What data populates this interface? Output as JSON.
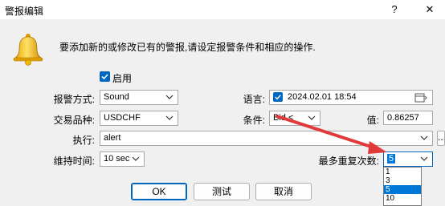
{
  "window": {
    "title": "警报编辑",
    "help": "?",
    "close": "✕"
  },
  "intro": {
    "text": "要添加新的或修改已有的警报,请设定报警条件和相应的操作."
  },
  "enable": {
    "label": "启用",
    "checked": true
  },
  "fields": {
    "type_label": "报警方式:",
    "type_value": "Sound",
    "symbol_label": "交易品种:",
    "symbol_value": "USDCHF",
    "lang_label": "语言:",
    "lang_value": "2024.02.01 18:54",
    "cond_label": "条件:",
    "cond_value": "Bid <",
    "value_label": "值:",
    "value_value": "0.86257",
    "exec_label": "执行:",
    "exec_value": "alert",
    "browse": "...",
    "duration_label": "维持时间:",
    "duration_value": "10 sec",
    "repeat_label": "最多重复次数:",
    "repeat_value": "5"
  },
  "repeat_options": [
    "1",
    "3",
    "5",
    "10"
  ],
  "repeat_selected_index": 2,
  "buttons": {
    "ok": "OK",
    "test": "测试",
    "cancel": "取消"
  },
  "colors": {
    "accent": "#0067c0",
    "arrow": "#e03a3a",
    "highlight": "#0078d7"
  },
  "icons": [
    "bell-icon",
    "checkbox-icon",
    "calendar-icon",
    "chevron-down-icon",
    "help-icon",
    "close-icon"
  ]
}
